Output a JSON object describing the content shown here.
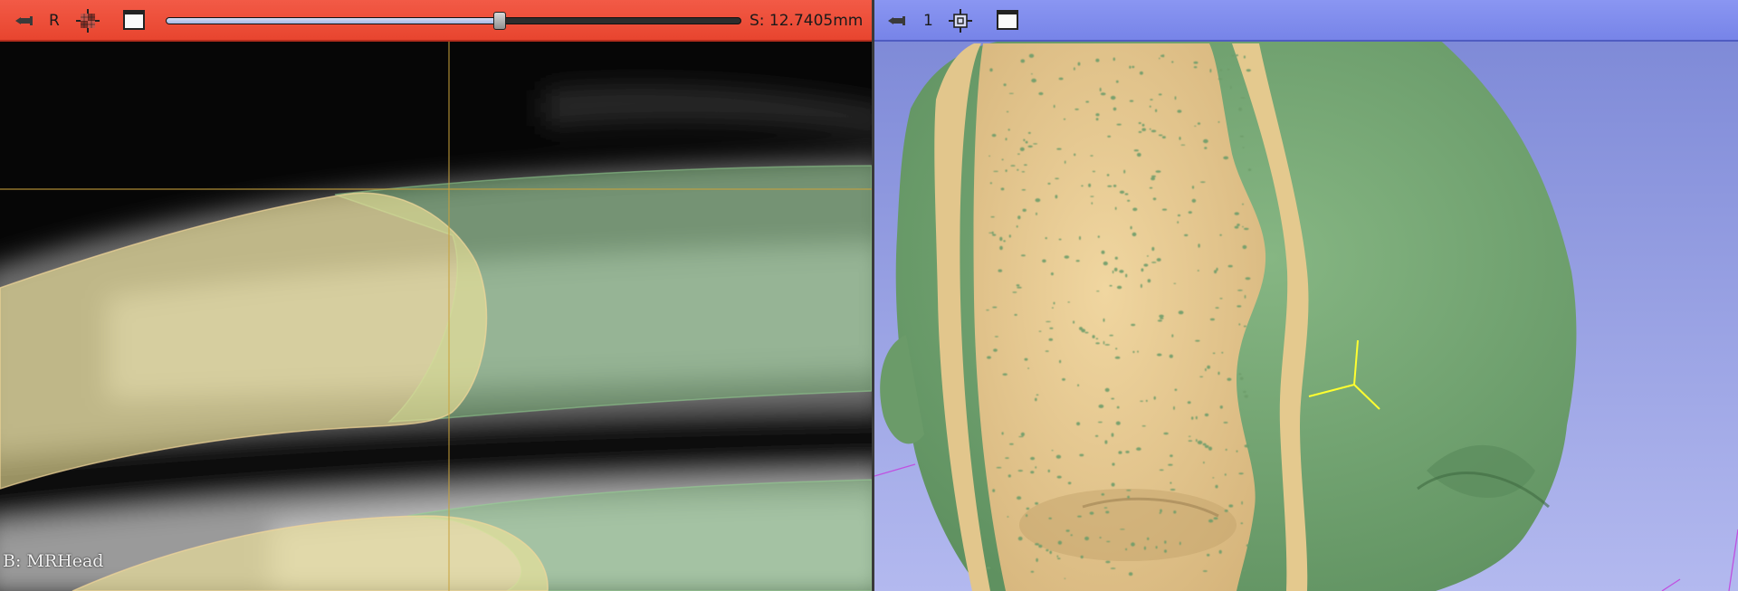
{
  "red_view": {
    "orientation_label": "R",
    "slice_offset_text": "S: 12.7405mm",
    "slider_position": 0.58,
    "corner_annotation": "B: MRHead",
    "bar_color": "#e8452f"
  },
  "green_3d_view": {
    "view_label": "1",
    "bar_color": "#7784e8",
    "background_top": "#7b87d6",
    "background_bottom": "#b3b9ef"
  },
  "colors": {
    "skin_segment": "#e8cd92",
    "tissue_segment": "#7cab79",
    "crosshair": "#c8a23c"
  },
  "icons": {
    "pin": "pin-icon",
    "slice_visibility": "slice-visibility-icon",
    "center_view": "center-view-icon",
    "maximize": "maximize-view-icon"
  }
}
